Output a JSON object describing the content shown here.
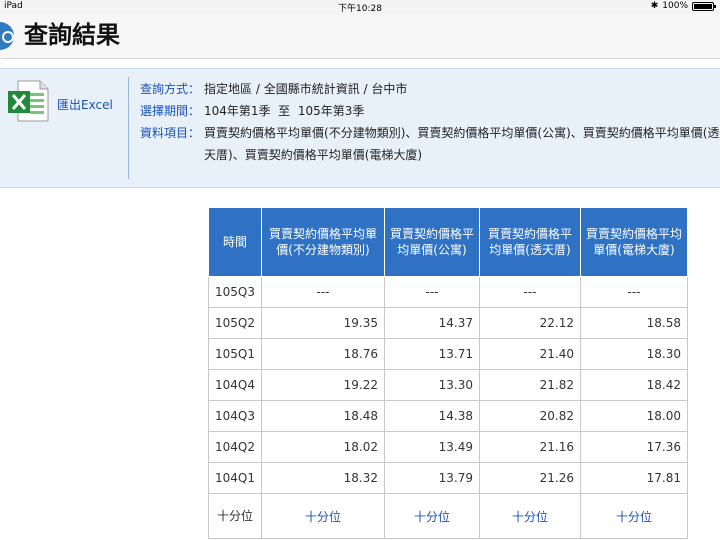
{
  "status_bar": {
    "device": "iPad",
    "time": "下午10:28",
    "battery": "100%",
    "battery_level": 1.0
  },
  "header": {
    "title": "查詢結果"
  },
  "export": {
    "label": "匯出Excel"
  },
  "query": {
    "method": {
      "label": "查詢方式：",
      "value": "指定地區 / 全國縣市統計資訊 / 台中市"
    },
    "period": {
      "label": "選擇期間：",
      "value": "104年第1季  至  105年第3季"
    },
    "items": {
      "label": "資料項目：",
      "value": "買賣契約價格平均單價(不分建物類別)、買賣契約價格平均單價(公寓)、買賣契約價格平均單價(透天厝)、買賣契約價格平均單價(電梯大廈)"
    }
  },
  "table": {
    "headers": [
      "時間",
      "買賣契約價格平均單價(不分建物類別)",
      "買賣契約價格平均單價(公寓)",
      "買賣契約價格平均單價(透天厝)",
      "買賣契約價格平均單價(電梯大廈)"
    ],
    "rows": [
      [
        "105Q3",
        "---",
        "---",
        "---",
        "---"
      ],
      [
        "105Q2",
        "19.35",
        "14.37",
        "22.12",
        "18.58"
      ],
      [
        "105Q1",
        "18.76",
        "13.71",
        "21.40",
        "18.30"
      ],
      [
        "104Q4",
        "19.22",
        "13.30",
        "21.82",
        "18.42"
      ],
      [
        "104Q3",
        "18.48",
        "14.38",
        "20.82",
        "18.00"
      ],
      [
        "104Q2",
        "18.02",
        "13.49",
        "21.16",
        "17.36"
      ],
      [
        "104Q1",
        "18.32",
        "13.79",
        "21.26",
        "17.81"
      ]
    ],
    "footer": {
      "label": "十分位",
      "links": [
        "十分位",
        "十分位",
        "十分位",
        "十分位"
      ]
    }
  },
  "colors": {
    "header_bg": "#2f72c4",
    "link": "#1a52b5",
    "panel_bg": "#e8f1fa"
  }
}
